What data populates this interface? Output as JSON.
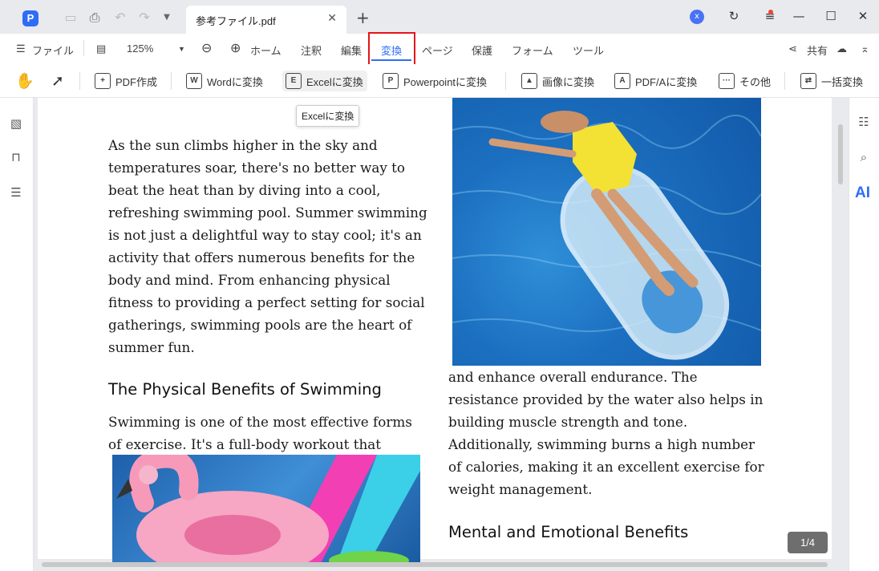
{
  "titlebar": {
    "app_logo": "P",
    "tab_title": "参考ファイル.pdf",
    "tab_close": "✕",
    "new_tab": "+",
    "user_initial": "x"
  },
  "menubar": {
    "file_label": "ファイル",
    "zoom_value": "125%",
    "tabs": [
      "ホーム",
      "注釈",
      "編集",
      "変換",
      "ページ",
      "保護",
      "フォーム",
      "ツール"
    ],
    "active_tab": "変換",
    "share_label": "共有"
  },
  "toolbar": {
    "pdf_create": "PDF作成",
    "to_word": "Wordに変換",
    "to_excel": "Excelに変換",
    "to_powerpoint": "Powerpointに変換",
    "to_image": "画像に変換",
    "to_pdfa": "PDF/Aに変換",
    "other": "その他",
    "batch": "一括変換"
  },
  "tooltip": "Excelに変換",
  "document": {
    "left_para": "As the sun climbs higher in the sky and temperatures soar, there's no better way to beat the heat than by diving into a cool, refreshing swimming pool. Summer swimming is not just a delightful way to stay cool; it's an activity that offers numerous benefits for the body and mind. From enhancing physical fitness to providing a perfect setting for social gatherings, swimming pools are the heart of summer fun.",
    "heading1": "The Physical Benefits of Swimming",
    "left_para2": "Swimming is one of the most effective forms of exercise. It's a full-body workout that",
    "right_para": "and enhance overall endurance. The resistance provided by the water also helps in building muscle strength and tone. Additionally, swimming burns a high number of calories, making it an excellent exercise for weight management.",
    "heading2": "Mental and Emotional Benefits"
  },
  "page_indicator": "1/4",
  "colors": {
    "accent": "#2f6df6",
    "highlight_box": "#e5141b"
  }
}
